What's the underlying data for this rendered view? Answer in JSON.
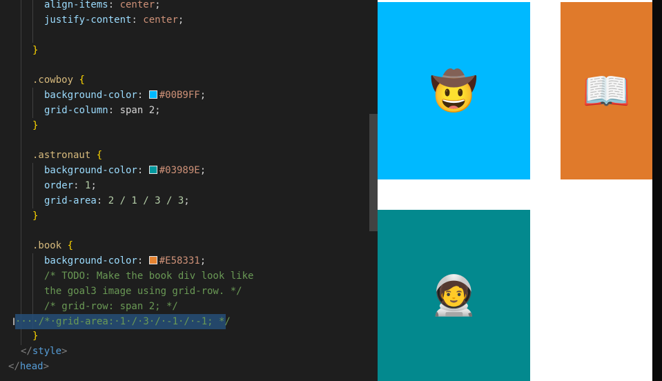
{
  "editor": {
    "lines": {
      "l1": {
        "prop": "align-items",
        "value": "center"
      },
      "l2": {
        "prop": "justify-content",
        "value": "center"
      },
      "l3": {
        "brace": "}"
      },
      "cowboy": {
        "selector": ".cowboy",
        "open": "{",
        "prop1": "background-color",
        "color": "#00B9FF",
        "prop2": "grid-column",
        "value2": "span 2",
        "close": "}"
      },
      "astronaut": {
        "selector": ".astronaut",
        "open": "{",
        "prop1": "background-color",
        "color": "#03989E",
        "prop2": "order",
        "value2": "1",
        "prop3": "grid-area",
        "value3": "2 / 1 / 3 / 3",
        "close": "}"
      },
      "book": {
        "selector": ".book",
        "open": "{",
        "prop1": "background-color",
        "color": "#E58331",
        "comment1": "/* TODO: Make the book div look like",
        "comment2": "the goal3 image using grid-row. */",
        "comment3": "/* grid-row: span 2; */",
        "comment4_sel": "····/*·grid-area:·1·/·3·/·-1·/·-1;",
        "comment4_end": " */",
        "close": "}"
      },
      "style_close": "</style>",
      "head_close": "</head>"
    }
  },
  "colors": {
    "cowboy": "#00B9FF",
    "astronaut": "#03989E",
    "book": "#E58331"
  },
  "preview": {
    "cowboy_emoji": "🤠",
    "book_emoji": "📖",
    "astronaut_emoji": "🧑‍🚀"
  }
}
